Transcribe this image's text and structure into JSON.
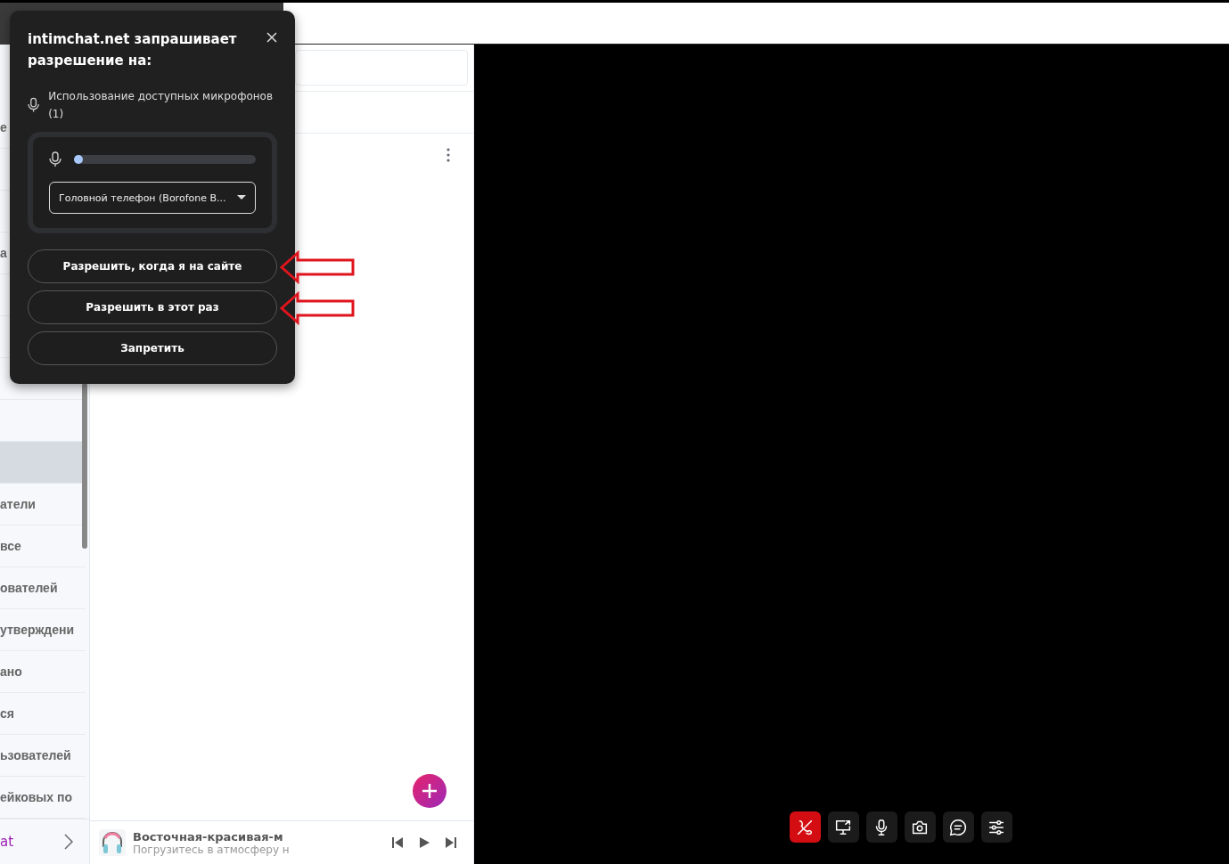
{
  "sidebar": {
    "items": [
      {
        "label": "е",
        "selected": false
      },
      {
        "selected": false
      },
      {
        "selected": false
      },
      {
        "label": "а",
        "selected": false
      },
      {
        "selected": false
      },
      {
        "selected": false
      },
      {
        "selected": false
      },
      {
        "selected": false
      },
      {
        "selected": true
      },
      {
        "label": "атели",
        "selected": false
      },
      {
        "label": "все",
        "selected": false
      },
      {
        "label": "ователей",
        "selected": false
      },
      {
        "label": "утверждени",
        "selected": false
      },
      {
        "label": "ано",
        "selected": false
      },
      {
        "label": "ся",
        "selected": false
      },
      {
        "label": "ьзователей",
        "selected": false
      },
      {
        "label": "ейковых по",
        "selected": false
      }
    ],
    "footer": "at"
  },
  "player": {
    "title": "Восточная-красивая-м",
    "subtitle": "Погрузитесь в атмосферу н"
  },
  "call_controls": [
    {
      "kind": "hangup"
    },
    {
      "kind": "screen"
    },
    {
      "kind": "mic"
    },
    {
      "kind": "camera"
    },
    {
      "kind": "chat"
    },
    {
      "kind": "settings"
    }
  ],
  "permission_popup": {
    "site": "intimchat.net",
    "title_rest": " запрашивает разрешение на:",
    "permission": "Использование доступных микрофонов (1)",
    "mic_level": {
      "level": 0.03
    },
    "device": "Головной телефон (Borofone B...",
    "buttons": [
      {
        "label": "Разрешить, когда я на сайте",
        "highlighted": true
      },
      {
        "label": "Разрешить в этот раз",
        "highlighted": true
      },
      {
        "label": "Запретить"
      }
    ]
  }
}
